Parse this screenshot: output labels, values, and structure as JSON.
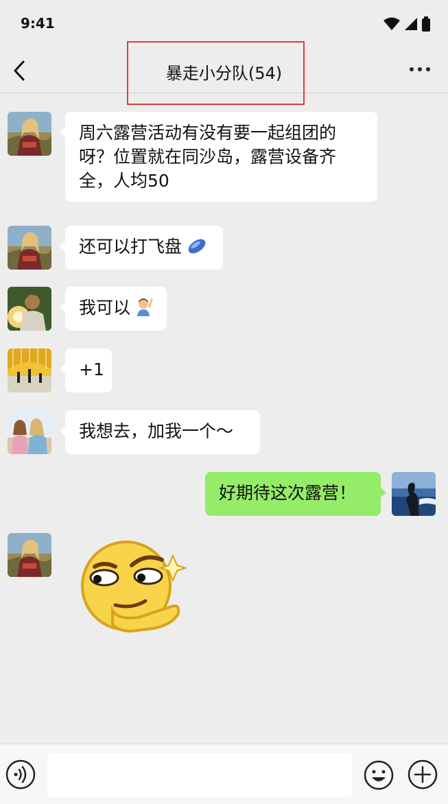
{
  "status_bar": {
    "time": "9:41"
  },
  "nav": {
    "title": "暴走小分队(54)"
  },
  "messages": [
    {
      "sender": "other",
      "avatar": "girl-mountain-avatar",
      "lines": [
        "周六露营活动有没有要一起组团的",
        "呀？位置就在同沙岛，露营设备齐",
        "全，人均50"
      ]
    },
    {
      "sender": "other",
      "avatar": "girl-mountain-avatar",
      "text": "还可以打飞盘",
      "emoji": "flying-disc-emoji"
    },
    {
      "sender": "other",
      "avatar": "boy-sunset-avatar",
      "text": "我可以",
      "emoji": "raising-hand-emoji"
    },
    {
      "sender": "other",
      "avatar": "yellow-tunnel-avatar",
      "text": "+1"
    },
    {
      "sender": "other",
      "avatar": "girls-beach-avatar",
      "text": "我想去，加我一个～"
    },
    {
      "sender": "me",
      "avatar": "seaside-silhouette-avatar",
      "text": "好期待这次露营！"
    },
    {
      "sender": "other",
      "avatar": "girl-mountain-avatar",
      "sticker": "smirk-sticker"
    }
  ],
  "colors": {
    "background": "#ededed",
    "my_bubble": "#95ec69",
    "other_bubble": "#ffffff",
    "highlight": "#e23b3b"
  }
}
